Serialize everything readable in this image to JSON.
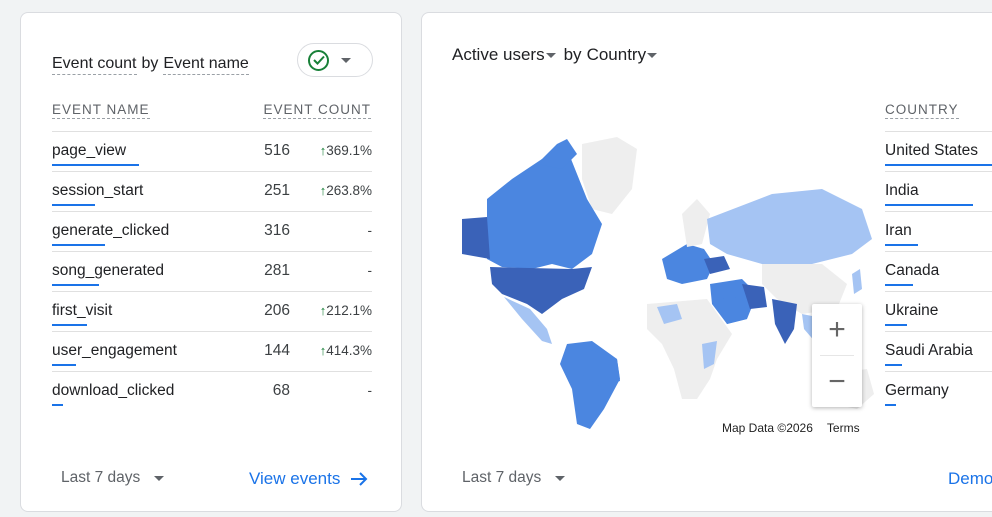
{
  "events_card": {
    "title_part1": "Event count",
    "title_by": "by",
    "title_part2": "Event name",
    "col_name": "EVENT NAME",
    "col_count": "EVENT COUNT",
    "rows": [
      {
        "name": "page_view",
        "count": "516",
        "change": "369.1%",
        "up": true,
        "bar_fraction": 1.0
      },
      {
        "name": "session_start",
        "count": "251",
        "change": "263.8%",
        "up": true,
        "bar_fraction": 0.49
      },
      {
        "name": "generate_clicked",
        "count": "316",
        "change": "-",
        "up": false,
        "bar_fraction": 0.61
      },
      {
        "name": "song_generated",
        "count": "281",
        "change": "-",
        "up": false,
        "bar_fraction": 0.54
      },
      {
        "name": "first_visit",
        "count": "206",
        "change": "212.1%",
        "up": true,
        "bar_fraction": 0.4
      },
      {
        "name": "user_engagement",
        "count": "144",
        "change": "414.3%",
        "up": true,
        "bar_fraction": 0.28
      },
      {
        "name": "download_clicked",
        "count": "68",
        "change": "-",
        "up": false,
        "bar_fraction": 0.13
      }
    ],
    "range_label": "Last 7 days",
    "link_label": "View events"
  },
  "users_card": {
    "metric": "Active users",
    "by": "by",
    "dimension": "Country",
    "col_country": "COUNTRY",
    "countries": [
      {
        "name": "United States",
        "bar_fraction": 1.0
      },
      {
        "name": "India",
        "bar_fraction": 0.8
      },
      {
        "name": "Iran",
        "bar_fraction": 0.3
      },
      {
        "name": "Canada",
        "bar_fraction": 0.25
      },
      {
        "name": "Ukraine",
        "bar_fraction": 0.2
      },
      {
        "name": "Saudi Arabia",
        "bar_fraction": 0.15
      },
      {
        "name": "Germany",
        "bar_fraction": 0.1
      }
    ],
    "map_credit": "Map Data ©2026",
    "map_terms": "Terms",
    "zoom_in": "+",
    "zoom_out": "−",
    "range_label": "Last 7 days",
    "link_label": "Demo"
  },
  "colors": {
    "accent": "#1a73e8",
    "positive": "#188038",
    "map_dark": "#3a62b8",
    "map_mid": "#4b86e0",
    "map_light": "#a5c4f3",
    "map_none": "#eeeeee"
  }
}
